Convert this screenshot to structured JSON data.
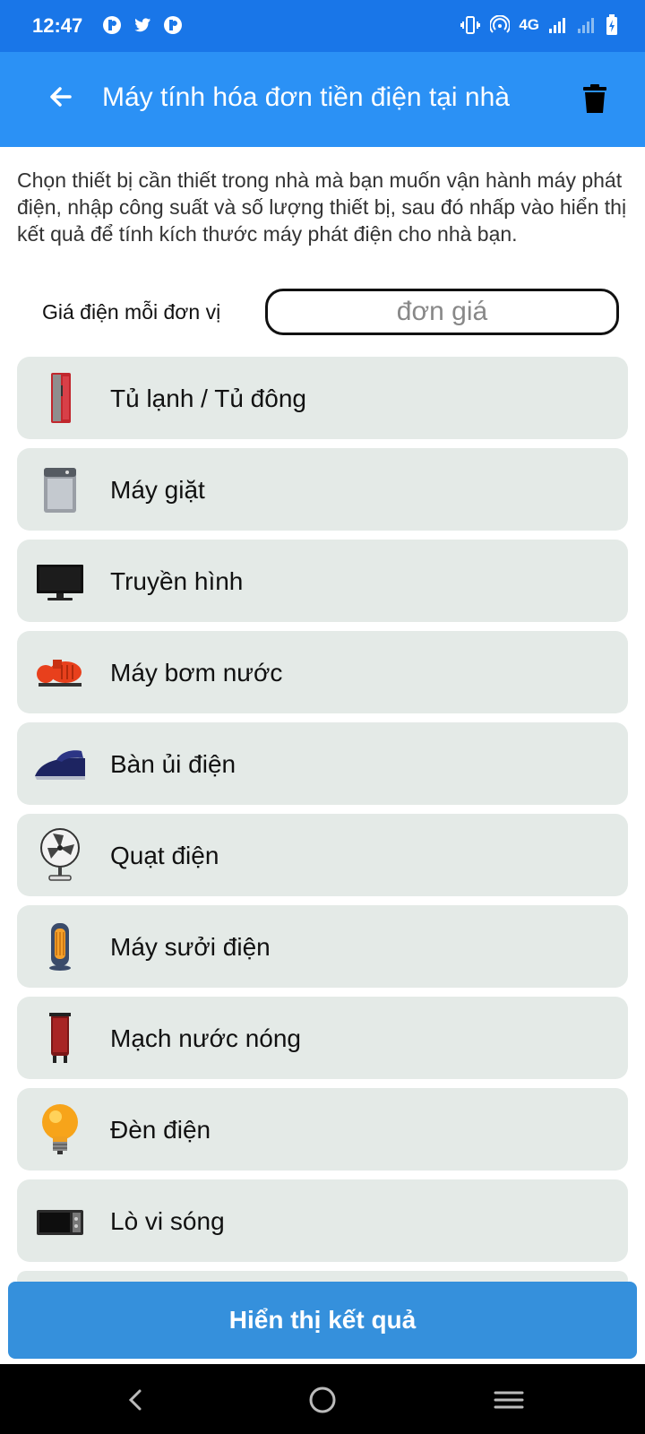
{
  "status": {
    "time": "12:47",
    "network": "4G"
  },
  "appbar": {
    "title": "Máy tính hóa đơn tiền điện tại nhà"
  },
  "intro": "Chọn thiết bị cần thiết trong nhà mà bạn muốn vận hành máy phát điện, nhập công suất và số lượng thiết bị, sau đó nhấp vào hiển thị kết quả để tính kích thước máy phát điện cho nhà bạn.",
  "price": {
    "label": "Giá điện mỗi đơn vị",
    "placeholder": "đơn giá"
  },
  "appliances": [
    {
      "label": "Tủ lạnh / Tủ đông",
      "icon": "fridge-icon"
    },
    {
      "label": "Máy giặt",
      "icon": "washing-machine-icon"
    },
    {
      "label": "Truyền hình",
      "icon": "tv-icon"
    },
    {
      "label": "Máy bơm nước",
      "icon": "water-pump-icon"
    },
    {
      "label": "Bàn ủi điện",
      "icon": "iron-icon"
    },
    {
      "label": "Quạt điện",
      "icon": "fan-icon"
    },
    {
      "label": "Máy sưởi điện",
      "icon": "heater-icon"
    },
    {
      "label": "Mạch nước nóng",
      "icon": "water-heater-icon"
    },
    {
      "label": "Đèn điện",
      "icon": "light-bulb-icon"
    },
    {
      "label": "Lò vi sóng",
      "icon": "microwave-icon"
    }
  ],
  "result_button": "Hiển thị kết quả"
}
